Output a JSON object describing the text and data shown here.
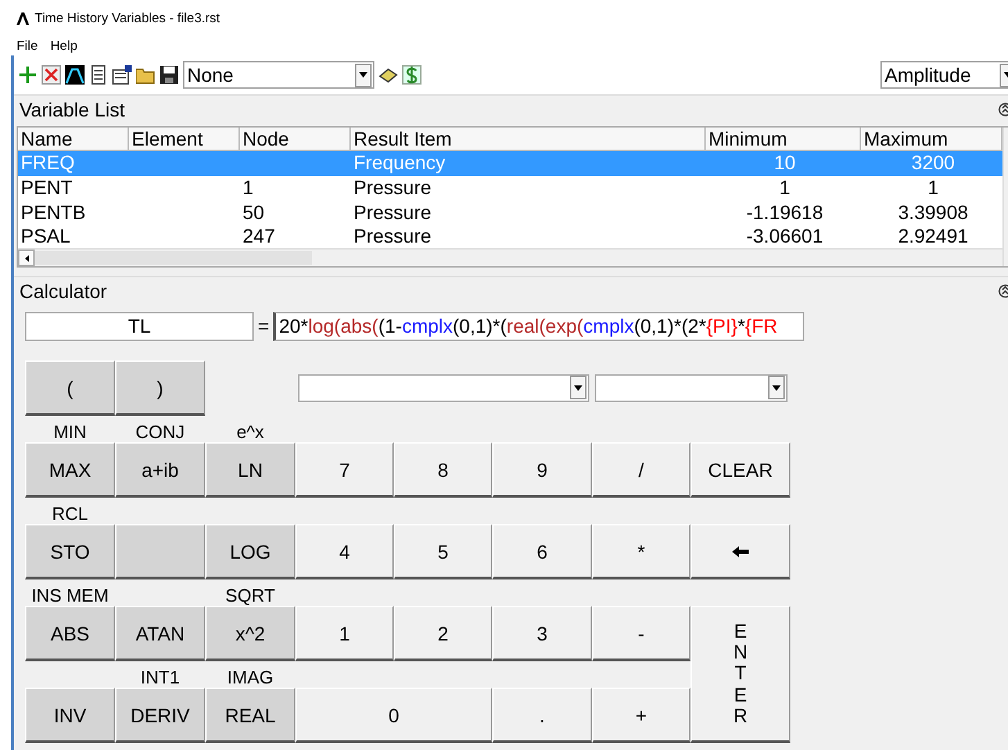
{
  "window": {
    "title": "Time History Variables - file3.rst"
  },
  "menu": [
    "File",
    "Help"
  ],
  "toolbar": {
    "combo": "None",
    "display": "Amplitude"
  },
  "variable_list": {
    "title": "Variable List",
    "columns": [
      "Name",
      "Element",
      "Node",
      "Result Item",
      "Minimum",
      "Maximum"
    ],
    "rows": [
      {
        "name": "FREQ",
        "node": null,
        "result": "Frequency",
        "minimum": "10",
        "maximum": "3200",
        "selected": true
      },
      {
        "name": "PENT",
        "node": "1",
        "result": "Pressure",
        "minimum": "1",
        "maximum": "1",
        "selected": false
      },
      {
        "name": "PENTB",
        "node": "50",
        "result": "Pressure",
        "minimum": "-1.19618",
        "maximum": "3.39908",
        "selected": false
      },
      {
        "name": "PSAL",
        "node": "247",
        "result": "Pressure",
        "minimum": "-3.06601",
        "maximum": "2.92491",
        "selected": false
      }
    ]
  },
  "calculator": {
    "title": "Calculator",
    "variable": "TL",
    "equals": "=",
    "expression": [
      {
        "text": "20*",
        "kind": "plain"
      },
      {
        "text": "log(",
        "kind": "function"
      },
      {
        "text": "abs(",
        "kind": "function"
      },
      {
        "text": "(1-",
        "kind": "plain"
      },
      {
        "text": "cmplx",
        "kind": "complex"
      },
      {
        "text": "(0,1)*(",
        "kind": "plain"
      },
      {
        "text": "real(",
        "kind": "function"
      },
      {
        "text": "exp(",
        "kind": "function"
      },
      {
        "text": "cmplx",
        "kind": "complex"
      },
      {
        "text": "(0,1)*(2*",
        "kind": "plain"
      },
      {
        "text": "{PI}",
        "kind": "variable"
      },
      {
        "text": "*",
        "kind": "plain"
      },
      {
        "text": "{FR",
        "kind": "variable"
      }
    ],
    "parens": [
      "(",
      ")"
    ],
    "function_rows": [
      [
        {
          "kind": "key",
          "label": "MAX",
          "shift": "MIN"
        },
        {
          "kind": "key",
          "label": "a+ib",
          "shift": "CONJ"
        },
        {
          "kind": "key",
          "label": "LN",
          "shift": "e^x"
        }
      ],
      [
        {
          "kind": "key",
          "label": "STO",
          "shift": "RCL"
        },
        {
          "kind": "blank"
        },
        {
          "kind": "key",
          "label": "LOG"
        }
      ],
      [
        {
          "kind": "key",
          "label": "ABS",
          "shift": "INS MEM"
        },
        {
          "kind": "key",
          "label": "ATAN"
        },
        {
          "kind": "key",
          "label": "x^2",
          "shift": "SQRT"
        }
      ],
      [
        {
          "kind": "key",
          "label": "INV"
        },
        {
          "kind": "key",
          "label": "DERIV",
          "shift": "INT1"
        },
        {
          "kind": "key",
          "label": "REAL",
          "shift": "IMAG"
        }
      ]
    ],
    "keypad_rows": [
      [
        {
          "kind": "key",
          "label": "7"
        },
        {
          "kind": "key",
          "label": "8"
        },
        {
          "kind": "key",
          "label": "9"
        },
        {
          "kind": "key",
          "label": "/"
        },
        {
          "kind": "key",
          "label": "CLEAR"
        }
      ],
      [
        {
          "kind": "key",
          "label": "4"
        },
        {
          "kind": "key",
          "label": "5"
        },
        {
          "kind": "key",
          "label": "6"
        },
        {
          "kind": "key",
          "label": "*"
        },
        {
          "kind": "backspace"
        }
      ],
      [
        {
          "kind": "key",
          "label": "1"
        },
        {
          "kind": "key",
          "label": "2"
        },
        {
          "kind": "key",
          "label": "3"
        },
        {
          "kind": "key",
          "label": "-"
        },
        {
          "kind": "tall",
          "label": "ENTER"
        }
      ],
      [
        {
          "kind": "wide",
          "label": "0"
        },
        {
          "kind": "key",
          "label": "."
        },
        {
          "kind": "key",
          "label": "+"
        }
      ]
    ]
  }
}
